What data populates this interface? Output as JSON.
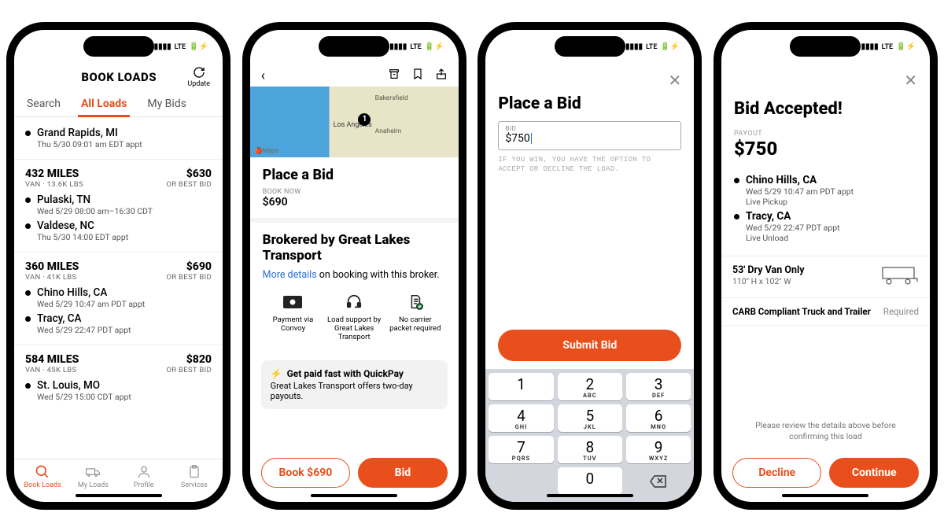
{
  "status_bar": {
    "network": "LTE"
  },
  "phone1": {
    "title": "BOOK LOADS",
    "update": "Update",
    "tabs": {
      "search": "Search",
      "all": "All Loads",
      "bids": "My Bids"
    },
    "top_stop": {
      "city": "Grand Rapids, MI",
      "time": "Thu 5/30 09:01 am EDT appt"
    },
    "loads": [
      {
        "distance": "432 MILES",
        "meta": "VAN · 13.6K LBS",
        "price": "$630",
        "bid": "OR BEST BID",
        "stops": [
          {
            "city": "Pulaski, TN",
            "time": "Wed 5/29 08:00 am–16:30 CDT"
          },
          {
            "city": "Valdese, NC",
            "time": "Thu 5/30 14:00 EDT appt"
          }
        ]
      },
      {
        "distance": "360 MILES",
        "meta": "VAN · 41K LBS",
        "price": "$690",
        "bid": "OR BEST BID",
        "stops": [
          {
            "city": "Chino Hills, CA",
            "time": "Wed 5/29 10:47 am PDT appt"
          },
          {
            "city": "Tracy, CA",
            "time": "Wed 5/29 22:47 PDT appt"
          }
        ]
      },
      {
        "distance": "584 MILES",
        "meta": "VAN · 45K LBS",
        "price": "$820",
        "bid": "OR BEST BID",
        "stops": [
          {
            "city": "St. Louis, MO",
            "time": "Wed 5/29 15:00 CDT appt"
          }
        ]
      }
    ],
    "nav": {
      "book": "Book Loads",
      "myloads": "My Loads",
      "profile": "Profile",
      "services": "Services"
    }
  },
  "phone2": {
    "title": "Place a Bid",
    "book_now_label": "BOOK NOW",
    "book_now_price": "$690",
    "map": {
      "city1": "Los Angeles",
      "city2": "Bakersfield",
      "city3": "Anaheim",
      "brand": "Maps"
    },
    "broker_title": "Brokered by Great Lakes Transport",
    "more_link": "More details",
    "more_text": " on booking with this broker.",
    "features": {
      "f1": "Payment via Convoy",
      "f2": "Load support by Great Lakes Transport",
      "f3": "No carrier packet required"
    },
    "quickpay_title": "Get paid fast with QuickPay",
    "quickpay_text": "Great Lakes Transport offers two-day payouts.",
    "book_btn": "Book $690",
    "bid_btn": "Bid"
  },
  "phone3": {
    "title": "Place a Bid",
    "input_label": "BID",
    "input_value": "$750",
    "disclaimer": "IF YOU WIN, YOU HAVE THE OPTION TO ACCEPT OR DECLINE THE LOAD.",
    "submit": "Submit Bid",
    "keys": {
      "k1": "1",
      "k2": "2",
      "k2l": "ABC",
      "k3": "3",
      "k3l": "DEF",
      "k4": "4",
      "k4l": "GHI",
      "k5": "5",
      "k5l": "JKL",
      "k6": "6",
      "k6l": "MNO",
      "k7": "7",
      "k7l": "PQRS",
      "k8": "8",
      "k8l": "TUV",
      "k9": "9",
      "k9l": "WXYZ",
      "k0": "0"
    }
  },
  "phone4": {
    "title": "Bid Accepted!",
    "payout_label": "PAYOUT",
    "payout": "$750",
    "stops": [
      {
        "city": "Chino Hills, CA",
        "time": "Wed 5/29 10:47 am PDT appt",
        "live": "Live Pickup"
      },
      {
        "city": "Tracy, CA",
        "time": "Wed 5/29 22:47 PDT appt",
        "live": "Live Unload"
      }
    ],
    "truck": "53' Dry Van Only",
    "truck_dim": "110\" H x 102\" W",
    "compliance": "CARB Compliant Truck and Trailer",
    "required": "Required",
    "review": "Please review the details above before confirming this load",
    "decline": "Decline",
    "continue": "Continue"
  }
}
